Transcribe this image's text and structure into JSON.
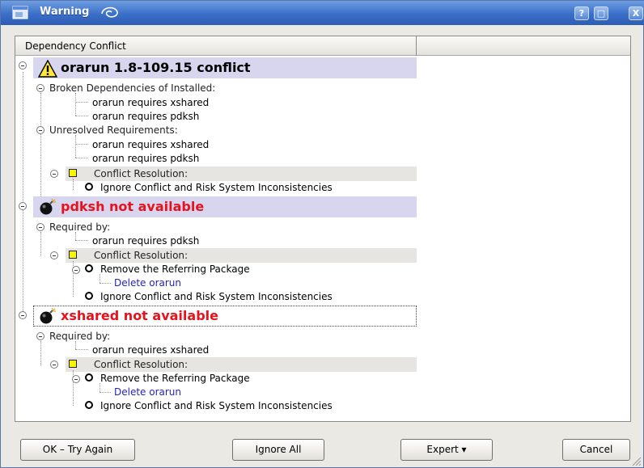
{
  "window": {
    "title": "Warning"
  },
  "titlebar_buttons": {
    "help": "?",
    "maximize": "□",
    "close": "X"
  },
  "columns": {
    "header": "Dependency Conflict"
  },
  "tree": {
    "c1": {
      "title": "orarun 1.8-109.15 conflict",
      "broken_label": "Broken Dependencies of Installed:",
      "broken_items": [
        "orarun requires xshared",
        "orarun requires pdksh"
      ],
      "unresolved_label": "Unresolved Requirements:",
      "unresolved_items": [
        "orarun requires xshared",
        "orarun requires pdksh"
      ],
      "resolution_label": "Conflict Resolution:",
      "ignore_label": "Ignore Conflict and Risk System Inconsistencies"
    },
    "c2": {
      "title": "pdksh not available",
      "required_label": "Required by:",
      "required_items": [
        "orarun requires pdksh"
      ],
      "resolution_label": "Conflict Resolution:",
      "remove_label": "Remove the Referring Package",
      "delete_label": "Delete orarun",
      "ignore_label": "Ignore Conflict and Risk System Inconsistencies"
    },
    "c3": {
      "title": "xshared not available",
      "required_label": "Required by:",
      "required_items": [
        "orarun requires xshared"
      ],
      "resolution_label": "Conflict Resolution:",
      "remove_label": "Remove the Referring Package",
      "delete_label": "Delete orarun",
      "ignore_label": "Ignore Conflict and Risk System Inconsistencies"
    }
  },
  "buttons": {
    "ok": "OK – Try Again",
    "ignore_all": "Ignore All",
    "expert": "Expert ▾",
    "cancel": "Cancel"
  },
  "colors": {
    "title_red": "#e8121c",
    "link_blue": "#2323b8",
    "selection": "#d7d6ee",
    "titlebar": "#3b6fc9"
  }
}
